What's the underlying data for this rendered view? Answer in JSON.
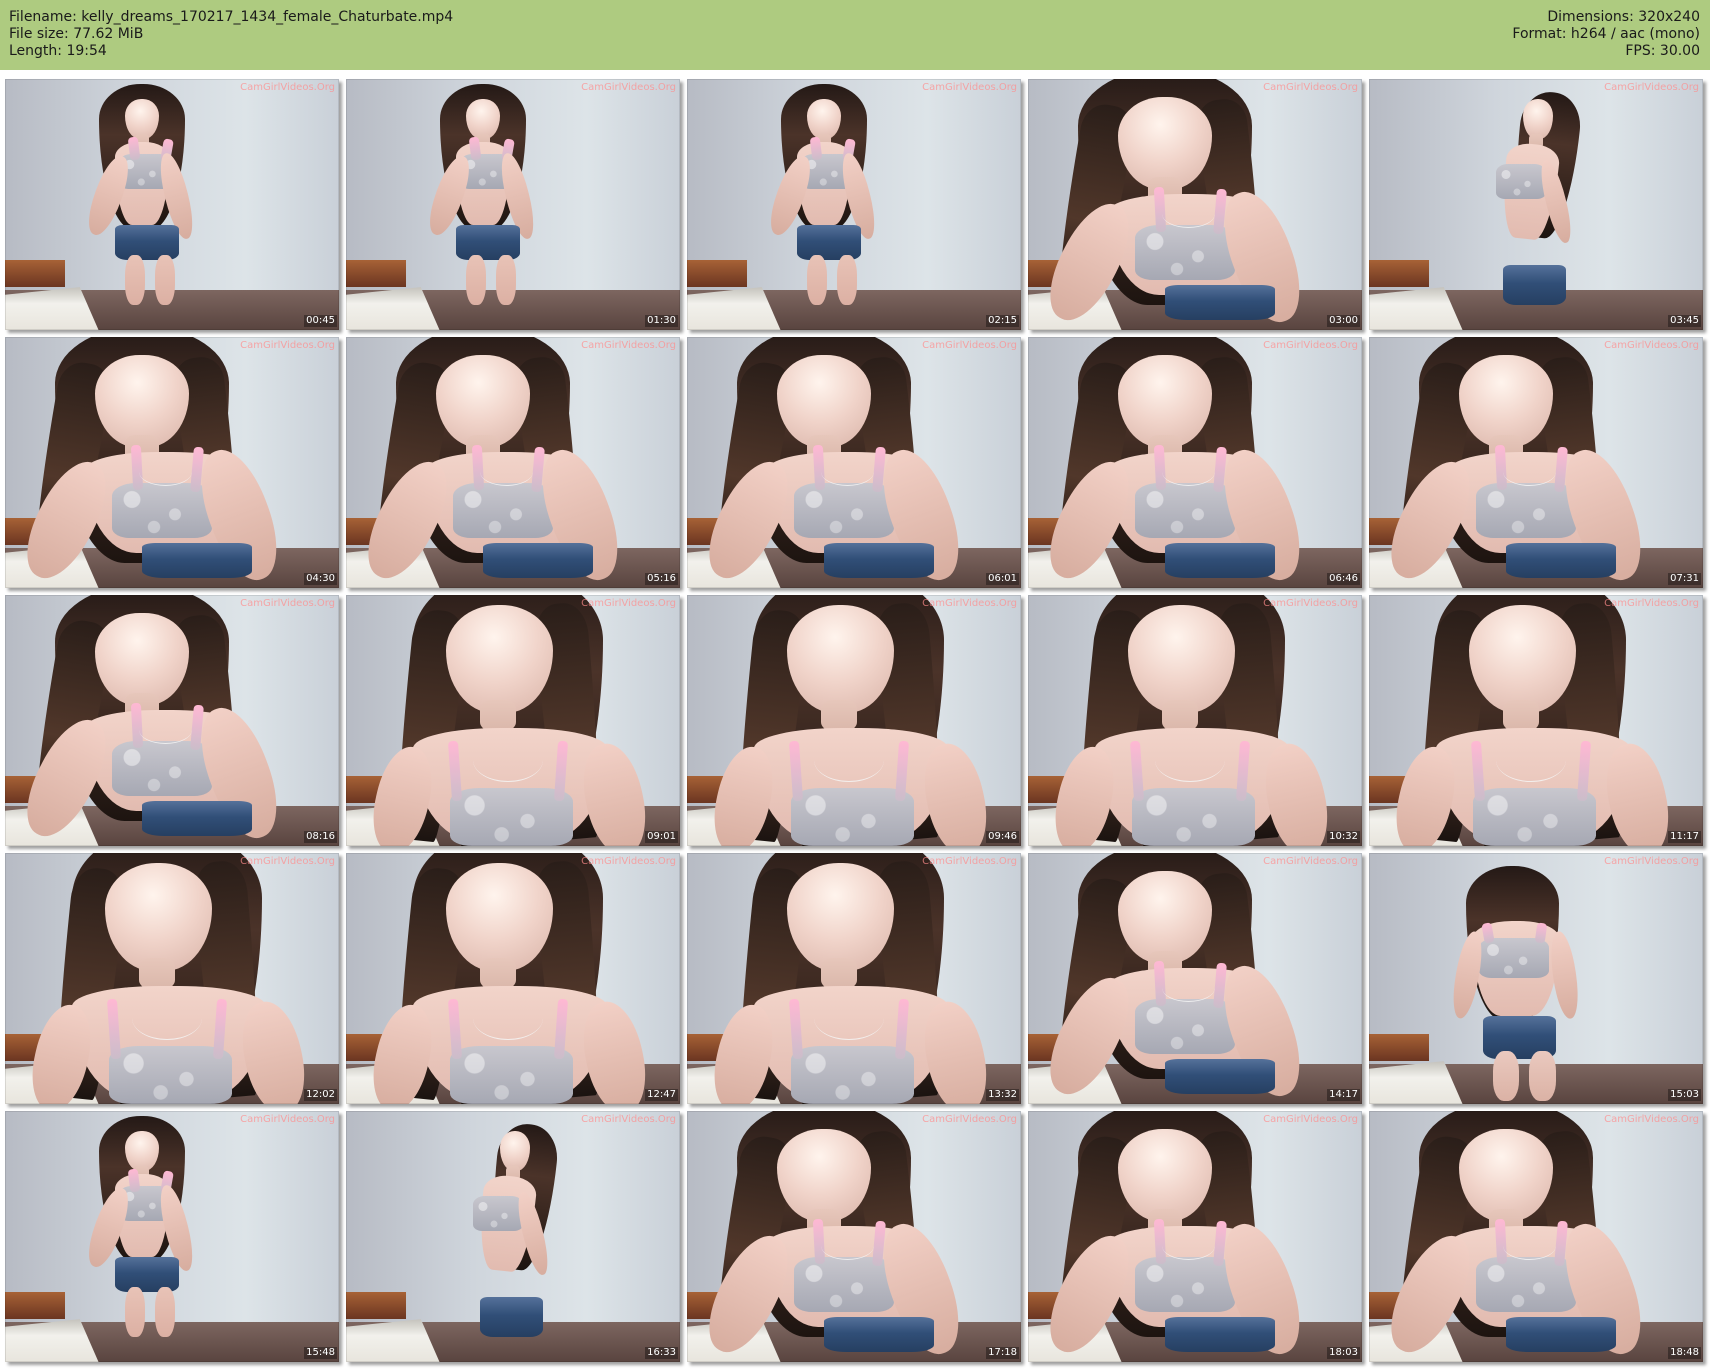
{
  "header": {
    "filename": "Filename: kelly_dreams_170217_1434_female_Chaturbate.mp4",
    "file_size": "File size: 77.62 MiB",
    "length": "Length: 19:54",
    "dimensions": "Dimensions: 320x240",
    "format": "Format: h264 / aac (mono)",
    "fps": "FPS: 30.00"
  },
  "thumbnails": [
    {
      "timestamp": "00:45",
      "watermark": "CamGirlVideos.Org"
    },
    {
      "timestamp": "01:30",
      "watermark": "CamGirlVideos.Org"
    },
    {
      "timestamp": "02:15",
      "watermark": "CamGirlVideos.Org"
    },
    {
      "timestamp": "03:00",
      "watermark": "CamGirlVideos.Org"
    },
    {
      "timestamp": "03:45",
      "watermark": "CamGirlVideos.Org"
    },
    {
      "timestamp": "04:30",
      "watermark": "CamGirlVideos.Org"
    },
    {
      "timestamp": "05:16",
      "watermark": "CamGirlVideos.Org"
    },
    {
      "timestamp": "06:01",
      "watermark": "CamGirlVideos.Org"
    },
    {
      "timestamp": "06:46",
      "watermark": "CamGirlVideos.Org"
    },
    {
      "timestamp": "07:31",
      "watermark": "CamGirlVideos.Org"
    },
    {
      "timestamp": "08:16",
      "watermark": "CamGirlVideos.Org"
    },
    {
      "timestamp": "09:01",
      "watermark": "CamGirlVideos.Org"
    },
    {
      "timestamp": "09:46",
      "watermark": "CamGirlVideos.Org"
    },
    {
      "timestamp": "10:32",
      "watermark": "CamGirlVideos.Org"
    },
    {
      "timestamp": "11:17",
      "watermark": "CamGirlVideos.Org"
    },
    {
      "timestamp": "12:02",
      "watermark": "CamGirlVideos.Org"
    },
    {
      "timestamp": "12:47",
      "watermark": "CamGirlVideos.Org"
    },
    {
      "timestamp": "13:32",
      "watermark": "CamGirlVideos.Org"
    },
    {
      "timestamp": "14:17",
      "watermark": "CamGirlVideos.Org"
    },
    {
      "timestamp": "15:03",
      "watermark": "CamGirlVideos.Org"
    },
    {
      "timestamp": "15:48",
      "watermark": "CamGirlVideos.Org"
    },
    {
      "timestamp": "16:33",
      "watermark": "CamGirlVideos.Org"
    },
    {
      "timestamp": "17:18",
      "watermark": "CamGirlVideos.Org"
    },
    {
      "timestamp": "18:03",
      "watermark": "CamGirlVideos.Org"
    },
    {
      "timestamp": "18:48",
      "watermark": "CamGirlVideos.Org"
    }
  ]
}
